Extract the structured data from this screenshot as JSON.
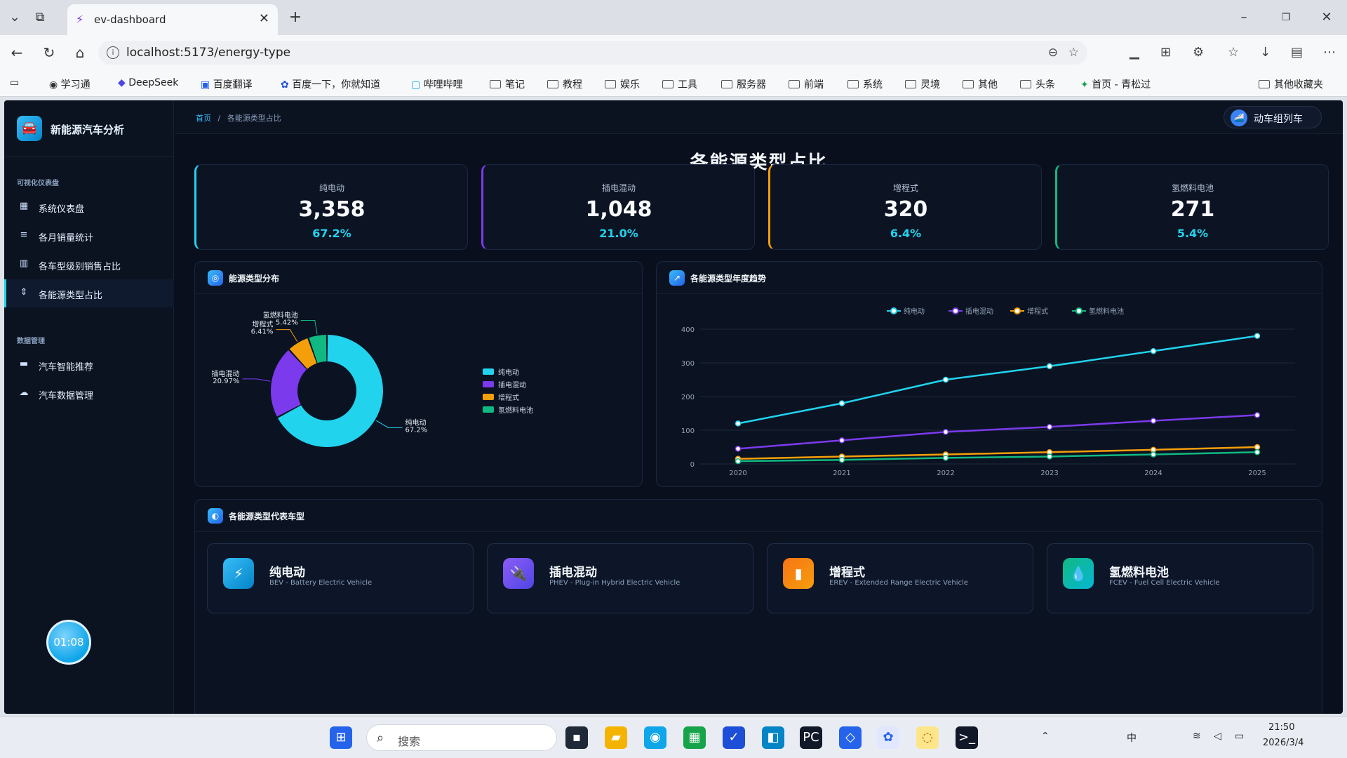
{
  "browser": {
    "tab_title": "ev-dashboard",
    "url": "localhost:5173/energy-type",
    "bookmarks": [
      "学习通",
      "DeepSeek",
      "百度翻译",
      "百度一下，你就知道",
      "哔哩哔哩",
      "笔记",
      "教程",
      "娱乐",
      "工具",
      "服务器",
      "前端",
      "系统",
      "灵境",
      "其他",
      "头条",
      "首页 - 青松过"
    ],
    "other_bookmarks": "其他收藏夹"
  },
  "app": {
    "name": "新能源汽车分析",
    "sidebar": {
      "group1": "可视化仪表盘",
      "items1": [
        "系统仪表盘",
        "各月销量统计",
        "各车型级别销售占比",
        "各能源类型占比"
      ],
      "group2": "数据管理",
      "items2": [
        "汽车智能推荐",
        "汽车数据管理"
      ]
    },
    "timer": "01:08",
    "breadcrumb": {
      "home": "首页",
      "sep": "/",
      "current": "各能源类型占比"
    },
    "user": "动车组列车",
    "page_title": "各能源类型占比",
    "cards": [
      {
        "label": "纯电动",
        "value": "3,358",
        "pct": "67.2%",
        "color": "#22d3ee"
      },
      {
        "label": "插电混动",
        "value": "1,048",
        "pct": "21.0%",
        "color": "#7c3aed"
      },
      {
        "label": "增程式",
        "value": "320",
        "pct": "6.4%",
        "color": "#f59e0b"
      },
      {
        "label": "氢燃料电池",
        "value": "271",
        "pct": "5.4%",
        "color": "#10b981"
      }
    ],
    "panel_dist": "能源类型分布",
    "panel_trend": "各能源类型年度趋势",
    "panel_models": "各能源类型代表车型",
    "models": [
      {
        "name": "纯电动",
        "sub": "BEV - Battery Electric Vehicle"
      },
      {
        "name": "插电混动",
        "sub": "PHEV - Plug-in Hybrid Electric Vehicle"
      },
      {
        "name": "增程式",
        "sub": "EREV - Extended Range Electric Vehicle"
      },
      {
        "name": "氢燃料电池",
        "sub": "FCEV - Fuel Cell Electric Vehicle"
      }
    ]
  },
  "chart_data": [
    {
      "type": "pie",
      "title": "能源类型分布",
      "donut": true,
      "legend": "right",
      "labels": [
        "纯电动",
        "插电混动",
        "增程式",
        "氢燃料电池"
      ],
      "values": [
        67.2,
        20.97,
        6.41,
        5.42
      ],
      "slice_labels": [
        "纯电动\n67.2%",
        "插电混动\n20.97%",
        "增程式\n6.41%",
        "氢燃料电池\n5.42%"
      ],
      "colors": [
        "#22d3ee",
        "#7c3aed",
        "#f59e0b",
        "#10b981"
      ]
    },
    {
      "type": "line",
      "title": "各能源类型年度趋势",
      "legend": "top",
      "x": [
        "2020",
        "2021",
        "2022",
        "2023",
        "2024",
        "2025"
      ],
      "ylim": [
        0,
        400
      ],
      "yticks": [
        0,
        100,
        200,
        300,
        400
      ],
      "grid": true,
      "series": [
        {
          "name": "纯电动",
          "values": [
            120,
            180,
            250,
            290,
            335,
            380
          ],
          "color": "#22d3ee"
        },
        {
          "name": "插电混动",
          "values": [
            45,
            70,
            95,
            110,
            128,
            145
          ],
          "color": "#7c3aed"
        },
        {
          "name": "增程式",
          "values": [
            15,
            22,
            28,
            35,
            42,
            50
          ],
          "color": "#f59e0b"
        },
        {
          "name": "氢燃料电池",
          "values": [
            8,
            12,
            18,
            22,
            28,
            35
          ],
          "color": "#10b981"
        }
      ]
    }
  ],
  "taskbar": {
    "search": "搜索",
    "ime": "中",
    "time": "21:50",
    "date": "2026/3/4"
  }
}
